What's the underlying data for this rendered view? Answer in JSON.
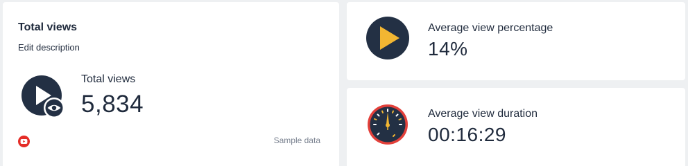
{
  "total_views_card": {
    "title": "Total views",
    "edit_description": "Edit description",
    "metric_label": "Total views",
    "metric_value": "5,834",
    "sample_label": "Sample data",
    "source_icon": "youtube-icon"
  },
  "avg_view_percentage_card": {
    "metric_label": "Average view percentage",
    "metric_value": "14%",
    "icon": "play-icon"
  },
  "avg_view_duration_card": {
    "metric_label": "Average view duration",
    "metric_value": "00:16:29",
    "icon": "gauge-icon"
  },
  "colors": {
    "navy": "#233044",
    "accent_yellow": "#f2b632",
    "youtube_red": "#e52d27",
    "background": "#eef0f2"
  }
}
